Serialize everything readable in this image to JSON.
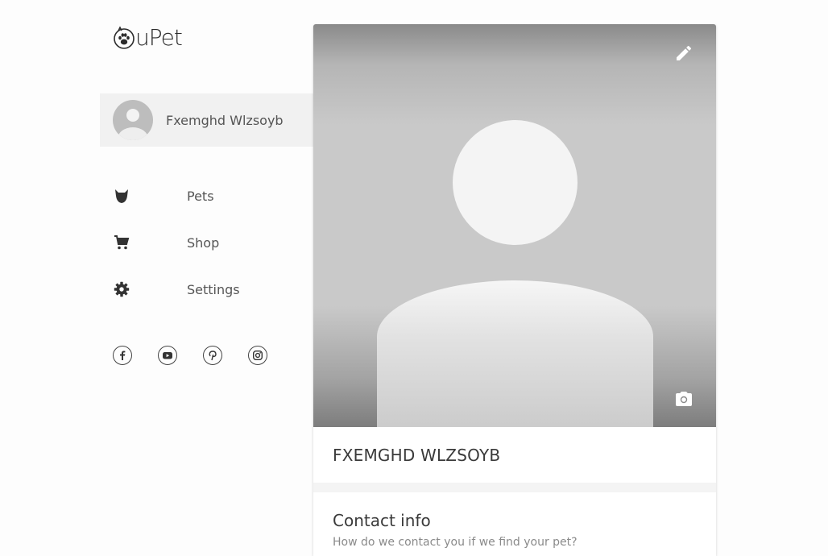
{
  "app": {
    "logo_text": "uPet"
  },
  "sidebar": {
    "profile_name": "Fxemghd Wlzsoyb",
    "nav": [
      {
        "label": "Pets",
        "icon": "dog-icon"
      },
      {
        "label": "Shop",
        "icon": "cart-icon"
      },
      {
        "label": "Settings",
        "icon": "gear-icon"
      }
    ],
    "social": [
      "facebook-icon",
      "youtube-icon",
      "pinterest-icon",
      "instagram-icon"
    ]
  },
  "profile": {
    "name_upper": "FXEMGHD WLZSOYB",
    "contact_title": "Contact info",
    "contact_subtitle": "How do we contact you if we find your pet?"
  },
  "colors": {
    "background": "#fdfdfd",
    "sidebar_active": "#f1f1f1",
    "text": "#4a4a4a"
  }
}
